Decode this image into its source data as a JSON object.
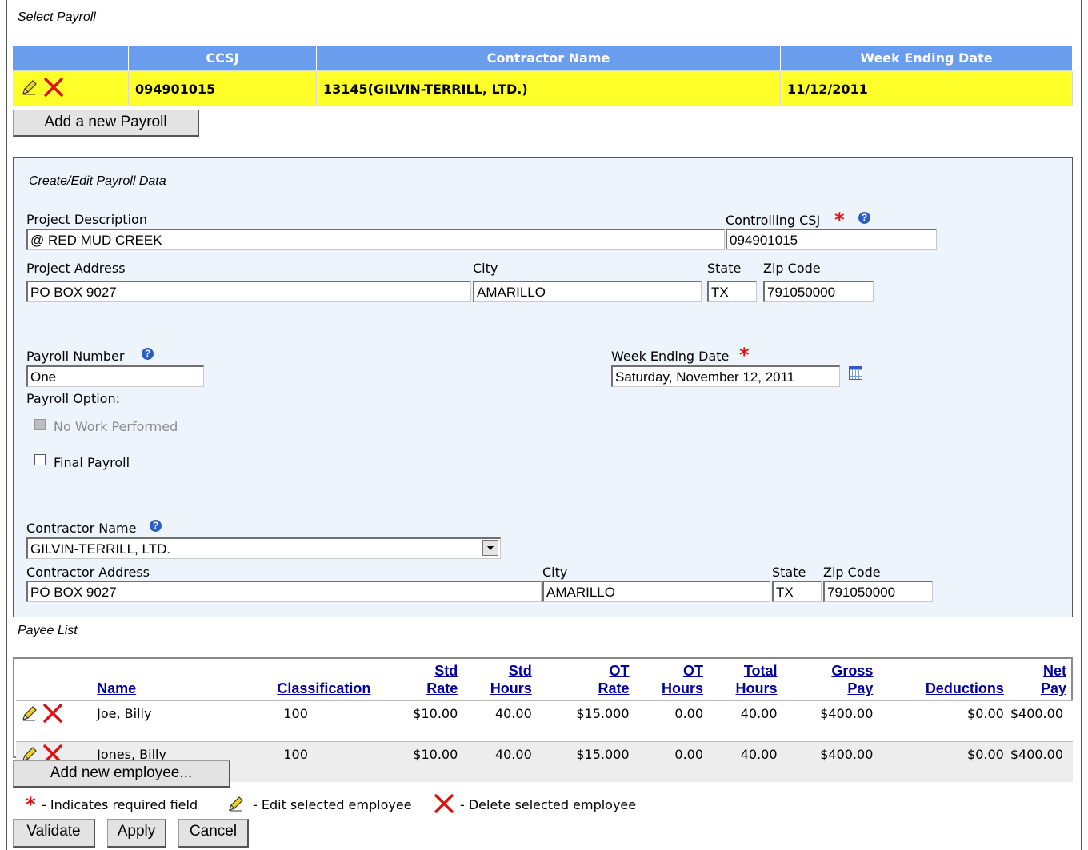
{
  "select_payroll": {
    "title": "Select Payroll",
    "columns": [
      "CCSJ",
      "Contractor Name",
      "Week Ending Date"
    ],
    "row": {
      "ccsj": "094901015",
      "contractor": "13145(GILVIN-TERRILL, LTD.)",
      "week_ending": "11/12/2011"
    },
    "add_button": "Add a new Payroll"
  },
  "edit_panel": {
    "title": "Create/Edit Payroll Data",
    "project_description_label": "Project Description",
    "project_description": "@ RED MUD CREEK",
    "controlling_csj_label": "Controlling CSJ",
    "controlling_csj": "094901015",
    "project_address_label": "Project Address",
    "project_address": "PO BOX 9027",
    "city_label": "City",
    "city": "AMARILLO",
    "state_label": "State",
    "state": "TX",
    "zip_label": "Zip Code",
    "zip": "791050000",
    "payroll_number_label": "Payroll Number",
    "payroll_number": "One",
    "week_ending_label": "Week Ending Date",
    "week_ending": "Saturday, November 12, 2011",
    "payroll_option_label": "Payroll Option:",
    "no_work_label": "No Work Performed",
    "final_payroll_label": "Final Payroll",
    "contractor_name_label": "Contractor Name",
    "contractor_name": "GILVIN-TERRILL, LTD.",
    "contractor_address_label": "Contractor Address",
    "contractor_address": "PO BOX 9027",
    "contractor_city_label": "City",
    "contractor_city": "AMARILLO",
    "contractor_state_label": "State",
    "contractor_state": "TX",
    "contractor_zip_label": "Zip Code",
    "contractor_zip": "791050000"
  },
  "payee_list": {
    "title": "Payee List",
    "headers": {
      "name": "Name",
      "classification": "Classification",
      "std_rate_1": "Std",
      "std_rate_2": "Rate",
      "std_hours_1": "Std",
      "std_hours_2": "Hours",
      "ot_rate_1": "OT",
      "ot_rate_2": "Rate",
      "ot_hours_1": "OT",
      "ot_hours_2": "Hours",
      "total_hours_1": "Total",
      "total_hours_2": "Hours",
      "gross_pay_1": "Gross",
      "gross_pay_2": "Pay",
      "deductions": "Deductions",
      "net_pay_1": "Net",
      "net_pay_2": "Pay"
    },
    "rows": [
      {
        "name": "Joe, Billy",
        "classification": "100",
        "std_rate": "$10.00",
        "std_hours": "40.00",
        "ot_rate": "$15.000",
        "ot_hours": "0.00",
        "total_hours": "40.00",
        "gross_pay": "$400.00",
        "deductions": "$0.00",
        "net_pay": "$400.00"
      },
      {
        "name": "Jones, Billy",
        "classification": "100",
        "std_rate": "$10.00",
        "std_hours": "40.00",
        "ot_rate": "$15.000",
        "ot_hours": "0.00",
        "total_hours": "40.00",
        "gross_pay": "$400.00",
        "deductions": "$0.00",
        "net_pay": "$400.00"
      }
    ],
    "add_button": "Add new employee..."
  },
  "legend": {
    "required": "- Indicates required field",
    "edit": "- Edit selected employee",
    "delete": "- Delete selected employee"
  },
  "buttons": {
    "validate": "Validate",
    "apply": "Apply",
    "cancel": "Cancel"
  },
  "colors": {
    "header_blue": "#6a9ded",
    "selected_yellow": "#ffff2a",
    "panel_bg": "#eef4fb",
    "link_blue": "#00009b",
    "required_red": "#e01010"
  },
  "icons": {
    "edit": "pencil-icon",
    "delete": "red-x-icon",
    "help": "question-help-icon",
    "calendar": "calendar-icon",
    "dropdown": "dropdown-arrow-icon"
  }
}
